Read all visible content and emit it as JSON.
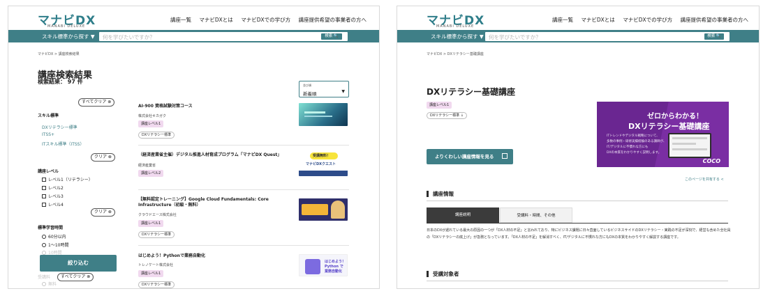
{
  "header": {
    "logo": "マナビDX",
    "logo_sub": "MANABI DELUXE",
    "nav": [
      "講座一覧",
      "マナビDXとは",
      "マナビDXでの学び方",
      "講座提供希望の事業者の方へ"
    ]
  },
  "search": {
    "skill_label": "スキル標準から探す ▼",
    "placeholder": "何を学びたいですか？",
    "button": "検索 🔍"
  },
  "search_page": {
    "breadcrumb": "マナビDX > 講座検索結果",
    "title": "講座検索結果",
    "count": "検索結果： 97 件",
    "sort_label": "並び順",
    "sort_value": "新着順",
    "sort_caret": "▼",
    "clear_all": "すべてクリア ⊗",
    "clear": "クリア ⊗",
    "filters": {
      "skill_title": "スキル標準",
      "skill_links": [
        "DXリテラシー標準",
        "ITSS+",
        "ITスキル標準（ITSS）"
      ],
      "level_title": "講座レベル",
      "levels": [
        "レベル1（リテラシー）",
        "レベル2",
        "レベル3",
        "レベル4"
      ],
      "time_title": "標準学習時間",
      "times": [
        "60分以内",
        "1～10時間",
        "10時間",
        "受講料",
        "無料"
      ]
    },
    "apply_button": "絞り込む",
    "courses": [
      {
        "title": "AI-900 資格試験対策コース",
        "org": "株式会社キカガク",
        "level": "講座レベル1",
        "std": "DXリテラシー標準"
      },
      {
        "title": "（経済産業省主催）デジタル推進人材育成プログラム「マナビDX Quest」",
        "org": "経済産業省",
        "level": "講座レベル2",
        "std": ""
      },
      {
        "title": "【無料認定トレーニング】Google Cloud Fundamentals: Core Infrastructure（初級・無料）",
        "org": "クラウドエース株式会社",
        "level": "講座レベル1",
        "std": "DXリテラシー標準"
      },
      {
        "title": "はじめよう！Pythonで業務自動化",
        "org": "トレノケート株式会社",
        "level": "講座レベル1",
        "std": "DXリテラシー標準"
      }
    ],
    "thumb_texts": [
      "受講無料！",
      "マナビDXクエスト",
      "はじめよう！",
      "Python で",
      "業務自動化"
    ]
  },
  "detail_page": {
    "breadcrumb": "マナビDX > DXリテラシー基礎講座",
    "title": "DXリテラシー基礎講座",
    "level_tag": "講座レベル1",
    "std_tag": "DXリテラシー標準 ↓",
    "hero": {
      "line1": "ゼロからわかる！",
      "line2": "DXリテラシー基礎講座",
      "desc": [
        "ITトレンドやデジタル戦略について、",
        "多数の事例・研修実績経験のある講師が、",
        "IT/デジタルに不慣れな方にも",
        "DXの本質をわかりやすく説明します。"
      ],
      "brand": "COCO"
    },
    "detail_button": "よりくわしい講座情報を見る",
    "share": "このページを共有する",
    "section_info": "講座情報",
    "tabs": [
      "講座説明",
      "受講料・時間、その他"
    ],
    "description": "日本のDXが遅れている最大の原因の一つが「DX人材の不足」と言われており、特にビジネス課題に日々直面しているビジネスサイドのDXリテラシー・実践の不足が深刻で、経営も含めた全社員の「DXリテラシーの底上げ」が急務となっています。「DX人材の不足」を解消すべく、IT/デジタルに不慣れな方にもDXの本質をわかりやすく解説する講座です。",
    "section_target": "受講対象者"
  },
  "colors": {
    "teal": "#3f7f87",
    "level_tag": "#f1d9ef",
    "hero": "#7a2ea3"
  }
}
